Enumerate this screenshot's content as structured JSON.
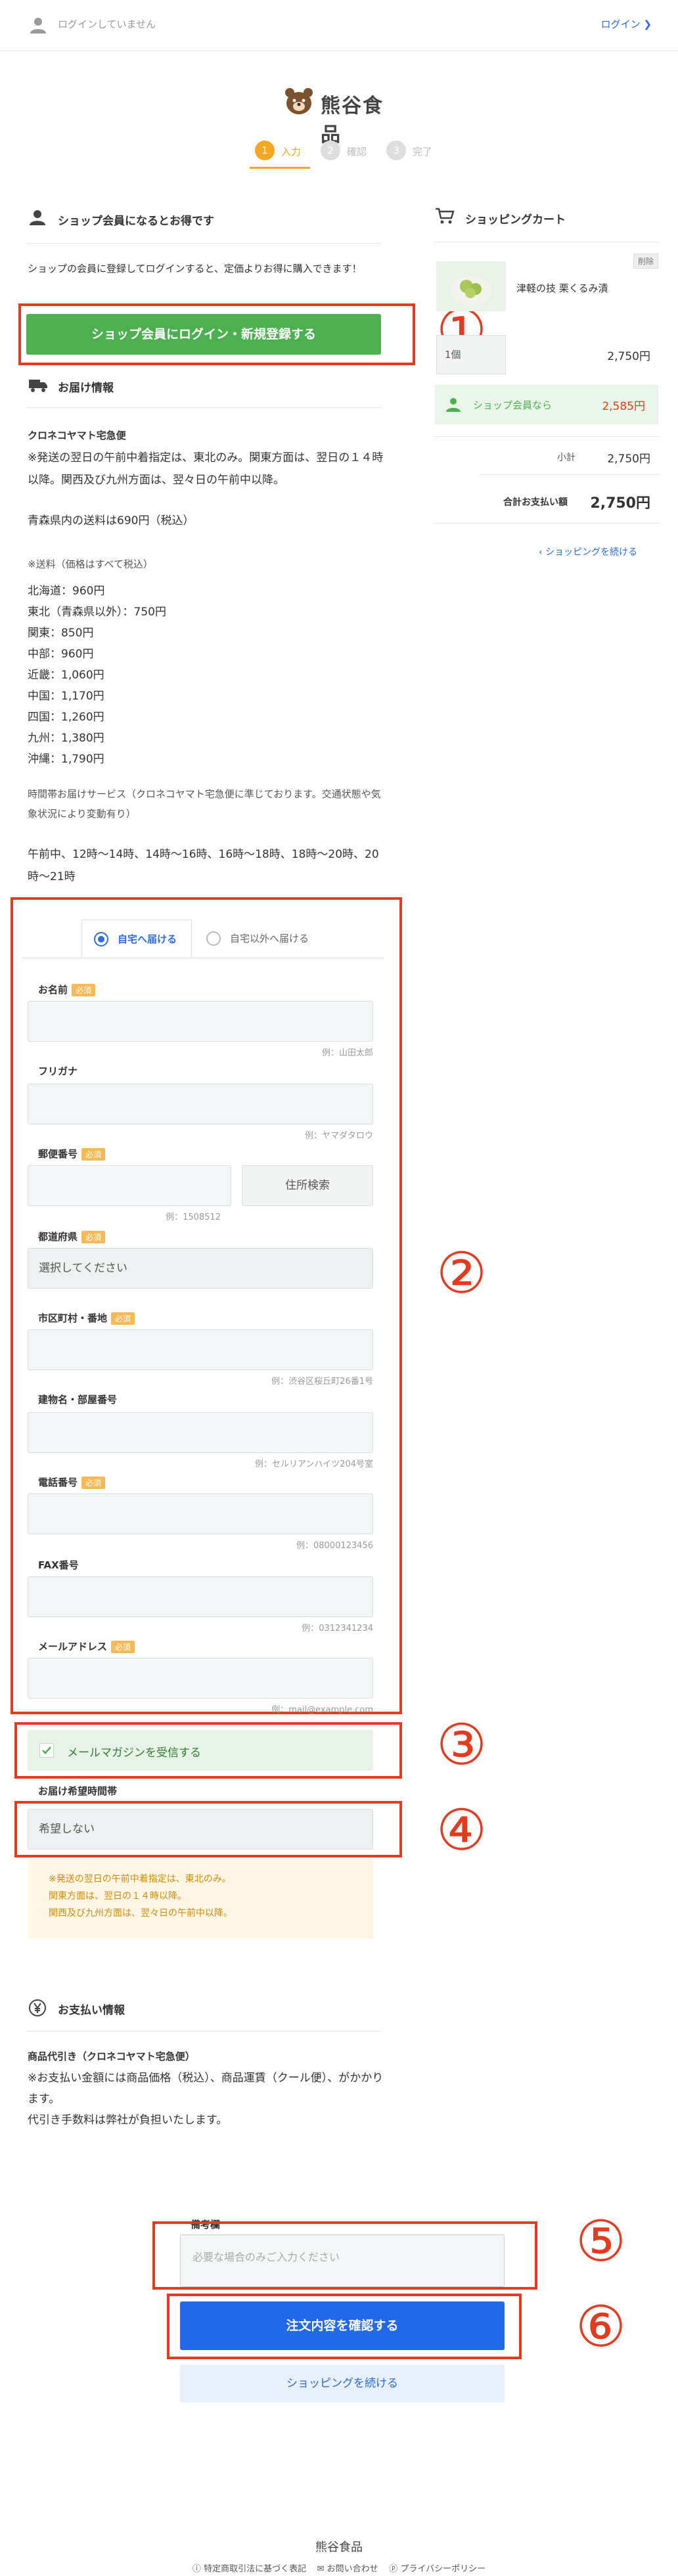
{
  "header": {
    "login_status": "ログインしていません",
    "login_link": "ログイン ❯"
  },
  "logo": {
    "text": "熊谷食品"
  },
  "steps": [
    {
      "num": "1",
      "label": "入力"
    },
    {
      "num": "2",
      "label": "確認"
    },
    {
      "num": "3",
      "label": "完了"
    }
  ],
  "member": {
    "title": "ショップ会員になるとお得です",
    "text": "ショップの会員に登録してログインすると、定価よりお得に購入できます！",
    "button": "ショップ会員にログイン・新規登録する"
  },
  "delivery": {
    "title": "お届け情報",
    "carrier": "クロネコヤマト宅急便",
    "note": "※発送の翌日の午前中着指定は、東北のみ。関東方面は、翌日の１４時以降。関西及び九州方面は、翌々日の午前中以降。",
    "aomori": "青森県内の送料は690円（税込）",
    "fee_title": "※送料（価格はすべて税込）",
    "fees": "北海道：960円\n東北（青森県以外）：750円\n関東：850円\n中部：960円\n近畿：1,060円\n中国：1,170円\n四国：1,260円\n九州：1,380円\n沖縄：1,790円",
    "time_note": "時間帯お届けサービス（クロネコヤマト宅急便に準じております。交通状態や気象状況により変動有り）",
    "times": "午前中、12時〜14時、14時〜16時、16時〜18時、18時〜20時、20時〜21時"
  },
  "form": {
    "tab_home": "自宅へ届ける",
    "tab_other": "自宅以外へ届ける",
    "required": "必須",
    "name_label": "お名前",
    "name_hint": "例：山田太郎",
    "kana_label": "フリガナ",
    "kana_hint": "例：ヤマダタロウ",
    "zip_label": "郵便番号",
    "zip_hint": "例：1508512",
    "zip_search": "住所検索",
    "pref_label": "都道府県",
    "pref_value": "選択してください",
    "city_label": "市区町村・番地",
    "city_hint": "例：渋谷区桜丘町26番1号",
    "building_label": "建物名・部屋番号",
    "building_hint": "例：セルリアンハイツ204号室",
    "tel_label": "電話番号",
    "tel_hint": "例：08000123456",
    "fax_label": "FAX番号",
    "fax_hint": "例：0312341234",
    "mail_label": "メールアドレス",
    "mail_hint": "例：mail@example.com",
    "magazine": "メールマガジンを受信する",
    "delivery_time_label": "お届け希望時間帯",
    "delivery_time_value": "希望しない",
    "delivery_warning": "※発送の翌日の午前中着指定は、東北のみ。\n関東方面は、翌日の１４時以降。\n関西及び九州方面は、翌々日の午前中以降。"
  },
  "payment": {
    "title": "お支払い情報",
    "method": "商品代引き（クロネコヤマト宅急便）",
    "text": "※お支払い金額には商品価格（税込）、商品運賃（クール便）、がかかります。\n代引き手数料は弊社が負担いたします。"
  },
  "remarks": {
    "label": "備考欄",
    "placeholder": "必要な場合のみご入力ください"
  },
  "actions": {
    "confirm": "注文内容を確認する",
    "continue": "ショッピングを続ける"
  },
  "cart": {
    "title": "ショッピングカート",
    "delete": "削除",
    "item_name": "津軽の技 栗くるみ漬",
    "qty": "1個",
    "item_price": "2,750円",
    "member_label": "ショップ会員なら",
    "member_price": "2,585円",
    "subtotal_label": "小計",
    "subtotal": "2,750円",
    "total_label": "合計お支払い額",
    "total": "2,750円",
    "continue": "ショッピングを続ける"
  },
  "markers": [
    "①",
    "②",
    "③",
    "④",
    "⑤",
    "⑥"
  ],
  "footer": {
    "title": "熊谷食品",
    "links": [
      "特定商取引法に基づく表記",
      "お問い合わせ",
      "プライバシーポリシー"
    ]
  },
  "colors": {
    "accent": "#f5a623",
    "primary": "#2169e8",
    "green": "#4caf50",
    "red_frame": "#e53a1e",
    "link": "#2a6ad6"
  }
}
